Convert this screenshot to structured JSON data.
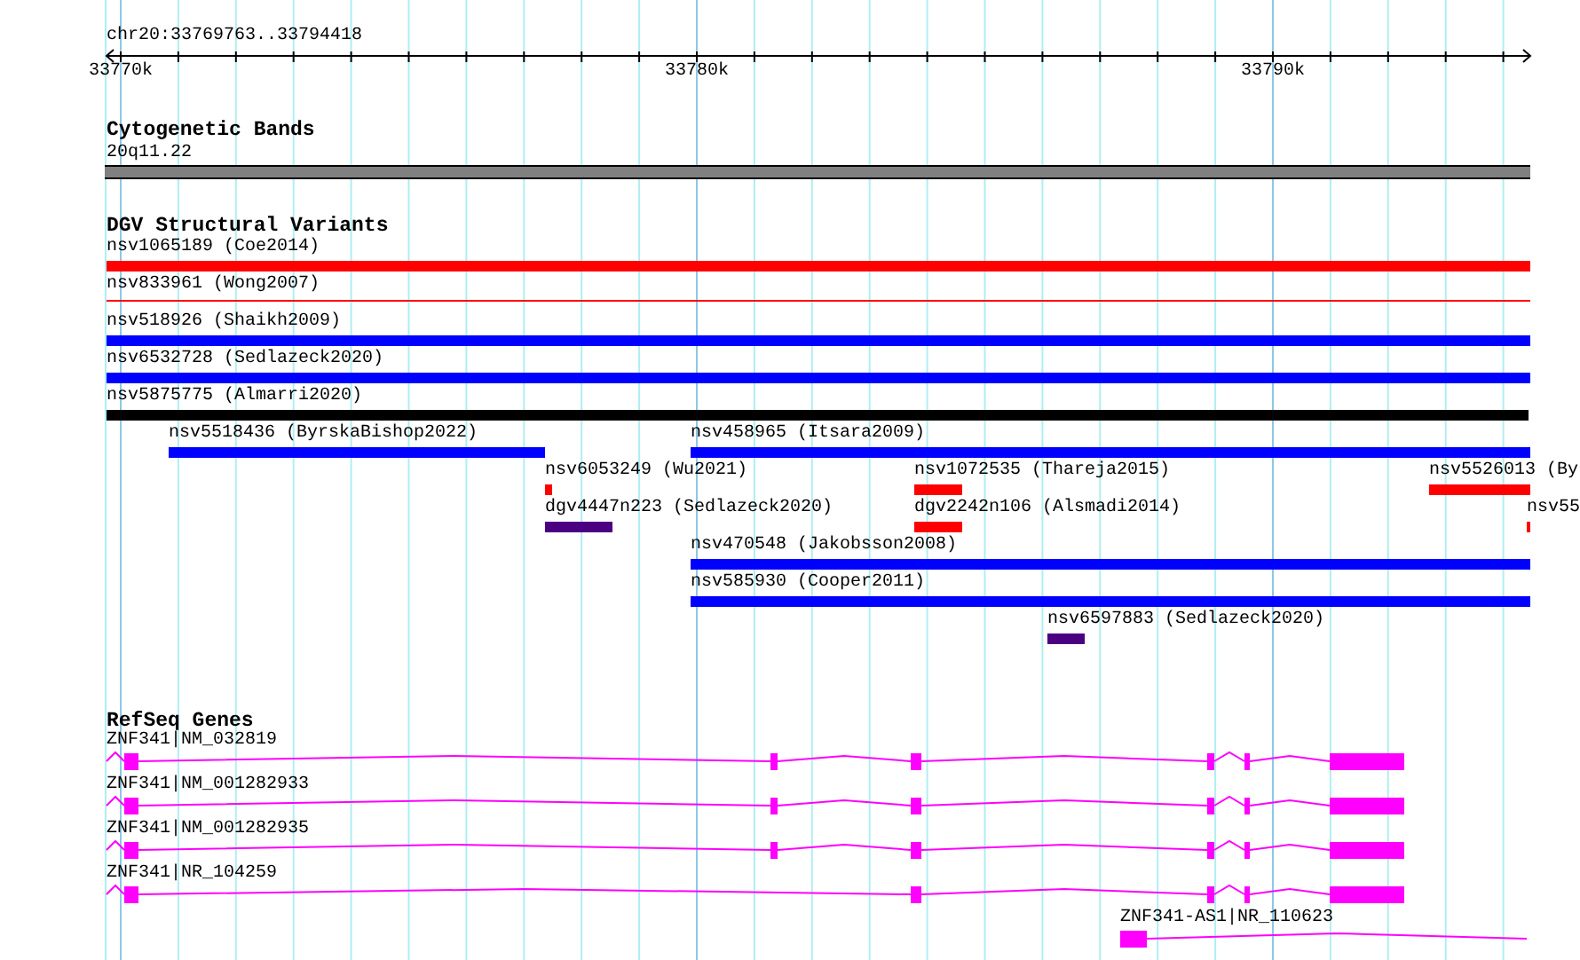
{
  "location": "chr20:33769763..33794418",
  "ruler": {
    "ticks": [
      "33770k",
      "33780k",
      "33790k"
    ]
  },
  "tracks": [
    {
      "kind": "bands",
      "title": "Cytogenetic Bands",
      "features": [
        {
          "label": "20q11.22",
          "color": "#808080"
        }
      ]
    },
    {
      "kind": "variants",
      "title": "DGV Structural Variants",
      "features": [
        {
          "label": "nsv1065189 (Coe2014)",
          "kind": "bar",
          "color": "#ff0000"
        },
        {
          "label": "nsv833961 (Wong2007)",
          "kind": "line",
          "color": "#ff0000"
        },
        {
          "label": "nsv518926 (Shaikh2009)",
          "kind": "bar",
          "color": "#0000ff"
        },
        {
          "label": "nsv6532728 (Sedlazeck2020)",
          "kind": "bar",
          "color": "#0000ff"
        },
        {
          "label": "nsv5875775 (Almarri2020)",
          "kind": "bar",
          "color": "#000000"
        },
        {
          "label": "nsv5518436 (ByrskaBishop2022)",
          "kind": "bar",
          "color": "#0000ff"
        },
        {
          "label": "nsv458965 (Itsara2009)",
          "kind": "bar",
          "color": "#0000ff"
        },
        {
          "label": "nsv6053249 (Wu2021)",
          "kind": "bar",
          "color": "#ff0000"
        },
        {
          "label": "nsv1072535 (Thareja2015)",
          "kind": "bar",
          "color": "#ff0000"
        },
        {
          "label": "nsv5526013 (By",
          "kind": "bar",
          "color": "#ff0000"
        },
        {
          "label": "dgv4447n223 (Sedlazeck2020)",
          "kind": "bar",
          "color": "#4b0082"
        },
        {
          "label": "dgv2242n106 (Alsmadi2014)",
          "kind": "bar",
          "color": "#ff0000"
        },
        {
          "label": "nsv55",
          "kind": "bar",
          "color": "#ff0000"
        },
        {
          "label": "nsv470548 (Jakobsson2008)",
          "kind": "bar",
          "color": "#0000ff"
        },
        {
          "label": "nsv585930 (Cooper2011)",
          "kind": "bar",
          "color": "#0000ff"
        },
        {
          "label": "nsv6597883 (Sedlazeck2020)",
          "kind": "bar",
          "color": "#4b0082"
        }
      ]
    },
    {
      "kind": "genes",
      "title": "RefSeq Genes",
      "features": [
        {
          "label": "ZNF341|NM_032819"
        },
        {
          "label": "ZNF341|NM_001282933"
        },
        {
          "label": "ZNF341|NM_001282935"
        },
        {
          "label": "ZNF341|NR_104259"
        },
        {
          "label": "ZNF341-AS1|NR_110623"
        }
      ]
    }
  ]
}
